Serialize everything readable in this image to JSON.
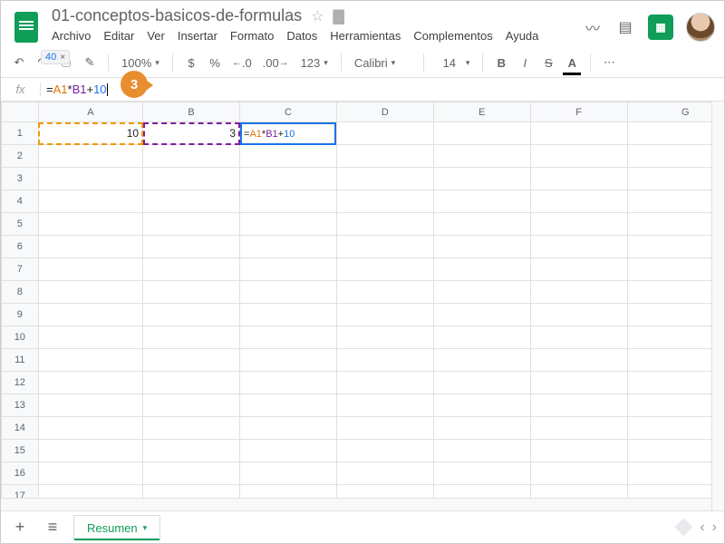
{
  "doc": {
    "title": "01-conceptos-basicos-de-formulas"
  },
  "menu": {
    "file": "Archivo",
    "edit": "Editar",
    "view": "Ver",
    "insert": "Insertar",
    "format": "Formato",
    "data": "Datos",
    "tools": "Herramientas",
    "addons": "Complementos",
    "help": "Ayuda"
  },
  "toolbar": {
    "zoom": "100%",
    "currency": "$",
    "percent": "%",
    "dec_dec": ".0",
    "inc_dec": ".00",
    "numfmt": "123",
    "font": "Calibri",
    "size": "14",
    "bold": "B",
    "italic": "I",
    "strike": "S",
    "textcolor": "A",
    "more": "⋯",
    "result_preview": "40",
    "result_close": "×"
  },
  "formula_bar": {
    "fx": "fx",
    "eq": "=",
    "refA": "A1",
    "op1": "*",
    "refB": "B1",
    "op2": "+",
    "lit": "10"
  },
  "step_badge": "3",
  "grid": {
    "cols": [
      "A",
      "B",
      "C",
      "D",
      "E",
      "F",
      "G"
    ],
    "rows": [
      "1",
      "2",
      "3",
      "4",
      "5",
      "6",
      "7",
      "8",
      "9",
      "10",
      "11",
      "12",
      "13",
      "14",
      "15",
      "16",
      "17"
    ],
    "A1": "10",
    "B1": "3",
    "C1_formula": {
      "eq": "=",
      "refA": "A1",
      "op1": "*",
      "refB": "B1",
      "op2": "+",
      "lit": "10"
    }
  },
  "tabs": {
    "sheet1": "Resumen"
  }
}
